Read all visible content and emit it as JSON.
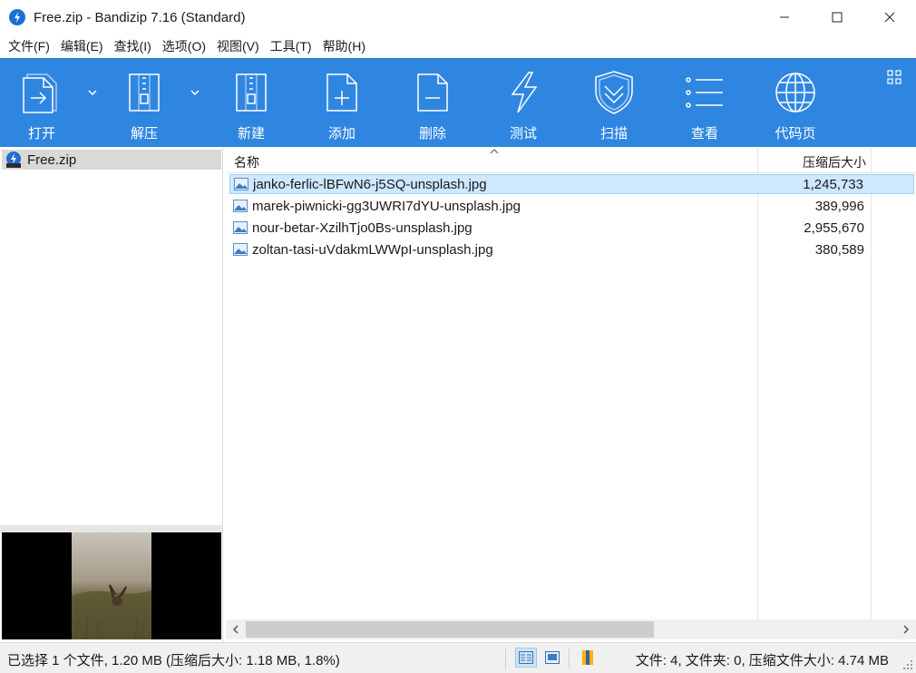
{
  "window": {
    "title": "Free.zip - Bandizip 7.16 (Standard)",
    "icons": {
      "app": "bandizip-logo-icon",
      "minimize": "minimize-icon",
      "maximize": "maximize-icon",
      "close": "close-icon"
    }
  },
  "menu": {
    "items": [
      "文件(F)",
      "编辑(E)",
      "查找(I)",
      "选项(O)",
      "视图(V)",
      "工具(T)",
      "帮助(H)"
    ]
  },
  "toolbar": {
    "background": "#2f86e0",
    "buttons": [
      {
        "label": "打开",
        "icon": "open-icon"
      },
      {
        "label": "解压",
        "icon": "extract-icon"
      },
      {
        "label": "新建",
        "icon": "new-archive-icon"
      },
      {
        "label": "添加",
        "icon": "add-icon"
      },
      {
        "label": "删除",
        "icon": "delete-icon"
      },
      {
        "label": "测试",
        "icon": "test-icon"
      },
      {
        "label": "扫描",
        "icon": "scan-shield-icon"
      },
      {
        "label": "查看",
        "icon": "view-list-icon"
      },
      {
        "label": "代码页",
        "icon": "codepage-globe-icon"
      }
    ]
  },
  "tree": {
    "items": [
      {
        "label": "Free.zip",
        "icon": "zip-archive-icon",
        "selected": true
      }
    ]
  },
  "filelist": {
    "columns": {
      "name": "名称",
      "size": "压缩后大小"
    },
    "rows": [
      {
        "name": "janko-ferlic-lBFwN6-j5SQ-unsplash.jpg",
        "size": "1,245,733",
        "selected": true
      },
      {
        "name": "marek-piwnicki-gg3UWRI7dYU-unsplash.jpg",
        "size": "389,996",
        "selected": false
      },
      {
        "name": "nour-betar-XzilhTjo0Bs-unsplash.jpg",
        "size": "2,955,670",
        "selected": false
      },
      {
        "name": "zoltan-tasi-uVdakmLWWpI-unsplash.jpg",
        "size": "380,589",
        "selected": false
      }
    ],
    "selection_color": "#cde8ff"
  },
  "status": {
    "left": "已选择 1 个文件, 1.20 MB (压缩后大小: 1.18 MB, 1.8%)",
    "right": "文件: 4, 文件夹: 0, 压缩文件大小: 4.74 MB"
  }
}
